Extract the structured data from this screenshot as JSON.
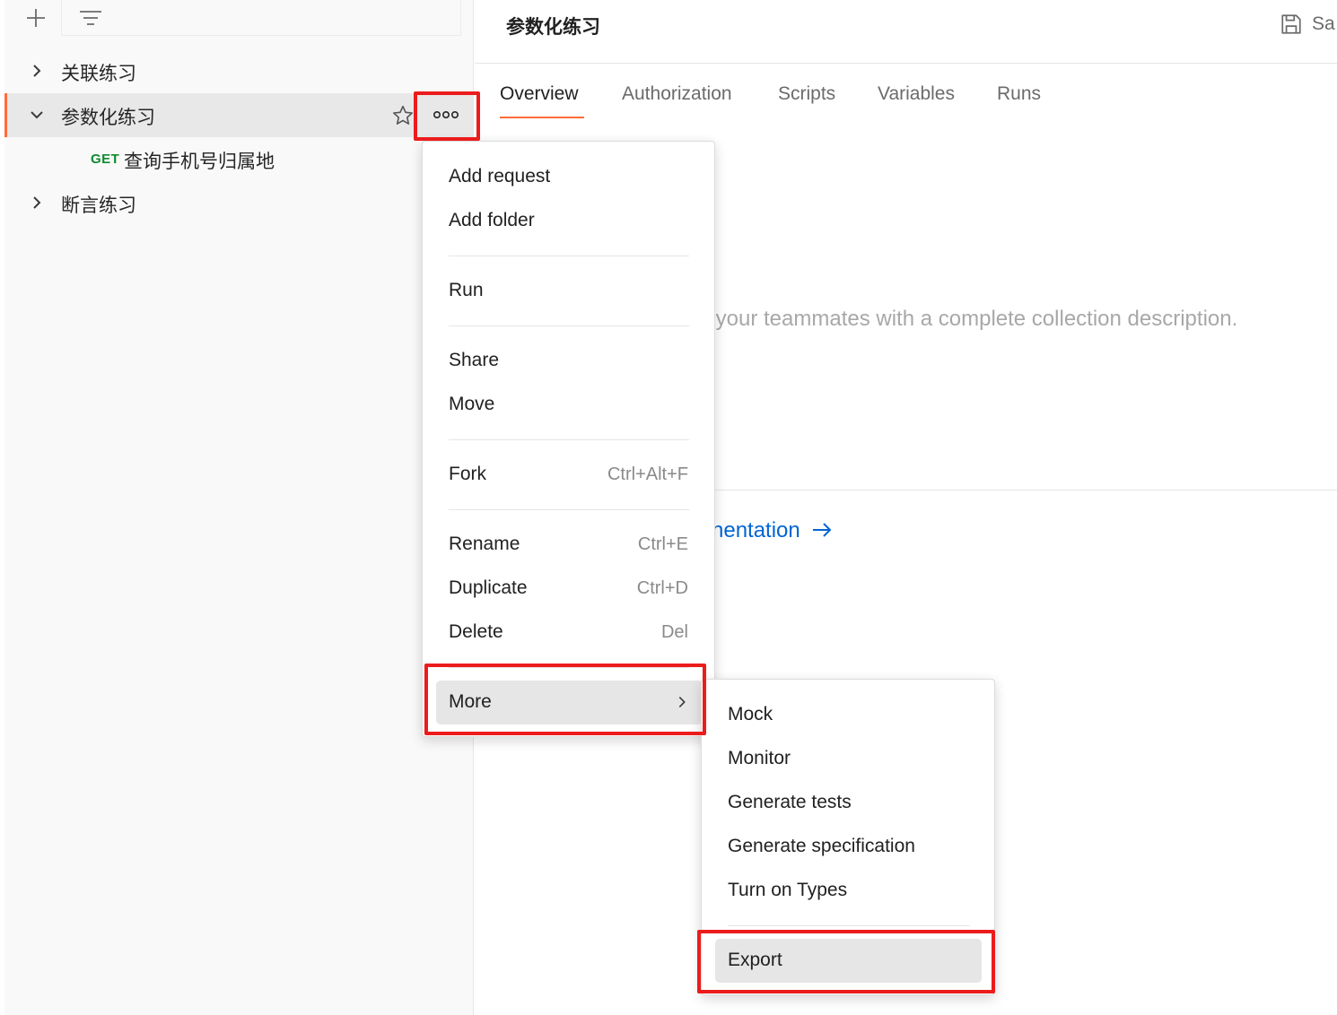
{
  "sidebar": {
    "toolbar": {
      "add_icon": "plus-icon",
      "filter_icon": "filter-icon"
    },
    "items": [
      {
        "label": "关联练习",
        "expanded": false
      },
      {
        "label": "参数化练习",
        "expanded": true,
        "selected": true
      },
      {
        "label": "断言练习",
        "expanded": false
      }
    ],
    "request": {
      "method": "GET",
      "label": "查询手机号归属地"
    }
  },
  "main": {
    "title": "参数化练习",
    "save_label": "Sa",
    "tabs": [
      "Overview",
      "Authorization",
      "Scripts",
      "Variables",
      "Runs"
    ],
    "active_tab": "Overview",
    "description_placeholder": "r your teammates with a complete collection description.",
    "doc_link": "nentation"
  },
  "context_menu": {
    "items": {
      "add_request": "Add request",
      "add_folder": "Add folder",
      "run": "Run",
      "share": "Share",
      "move": "Move",
      "fork": "Fork",
      "fork_shortcut": "Ctrl+Alt+F",
      "rename": "Rename",
      "rename_shortcut": "Ctrl+E",
      "duplicate": "Duplicate",
      "duplicate_shortcut": "Ctrl+D",
      "delete": "Delete",
      "delete_shortcut": "Del",
      "more": "More"
    }
  },
  "submenu": {
    "items": [
      "Mock",
      "Monitor",
      "Generate tests",
      "Generate specification",
      "Turn on Types"
    ],
    "export": "Export"
  },
  "colors": {
    "accent": "#ff6c37",
    "get_method": "#0f8a2e",
    "link": "#0265d2",
    "annotation_red": "#ec1c1c"
  }
}
